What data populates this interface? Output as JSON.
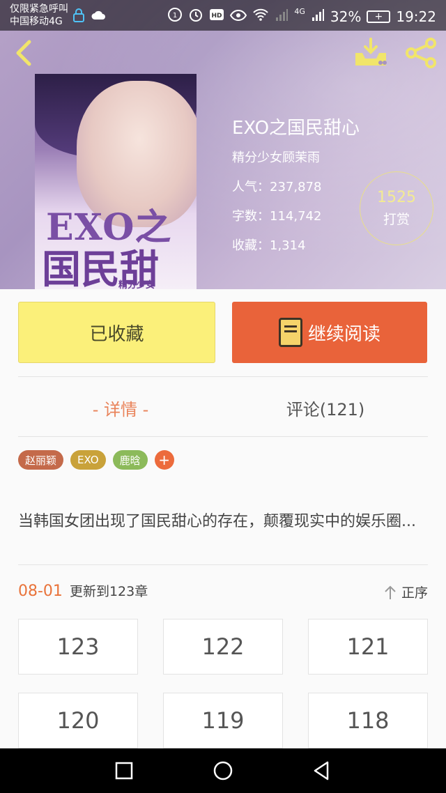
{
  "status_bar": {
    "carrier_line1": "仅限紧急呼叫",
    "carrier_line2": "中国移动4G",
    "network": "4G",
    "battery": "32%",
    "time": "19:22"
  },
  "book": {
    "title": "EXO之国民甜心",
    "author": "精分少女顾茉雨",
    "popularity_label": "人气：",
    "popularity_value": "237,878",
    "words_label": "字数：",
    "words_value": "114,742",
    "collect_label": "收藏：",
    "collect_value": "1,314",
    "cover_title_line1": "EXO之",
    "cover_title_line2": "国民甜心",
    "cover_subtitle": "精分少女"
  },
  "tip": {
    "count": "1525",
    "label": "打赏"
  },
  "actions": {
    "favorite_label": "已收藏",
    "read_label": "继续阅读"
  },
  "tabs": {
    "detail": "- 详情 -",
    "comments": "评论(121)"
  },
  "tags": [
    {
      "label": "赵丽颖",
      "color": "#c46a4a"
    },
    {
      "label": "EXO",
      "color": "#c9a23a"
    },
    {
      "label": "鹿晗",
      "color": "#8cba5a"
    }
  ],
  "tag_add": "+",
  "description": "当韩国女团出现了国民甜心的存在，颠覆现实中的娱乐圈...",
  "update": {
    "date": "08-01",
    "text": "更新到123章",
    "sort_label": "正序"
  },
  "chapters": [
    "123",
    "122",
    "121",
    "120",
    "119",
    "118"
  ],
  "colors": {
    "accent": "#e9633a",
    "favorite_bg": "#fbf07a",
    "tip_ring": "#e9df8a"
  }
}
